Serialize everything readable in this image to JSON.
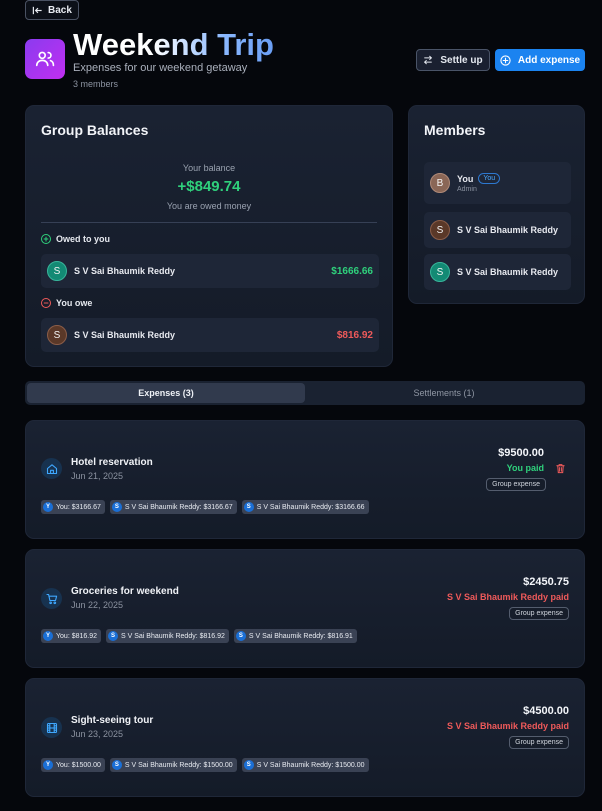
{
  "nav": {
    "back_label": "Back"
  },
  "header": {
    "title": "Weekend Trip",
    "subtitle": "Expenses for our weekend getaway",
    "member_count": "3 members",
    "settle_label": "Settle up",
    "add_label": "Add expense"
  },
  "balances": {
    "title": "Group Balances",
    "your_balance_label": "Your balance",
    "amount": "+$849.74",
    "status": "You are owed money",
    "owed_to_you": {
      "label": "Owed to you",
      "items": [
        {
          "initial": "S",
          "name": "S V Sai Bhaumik Reddy",
          "amount": "$1666.66"
        }
      ]
    },
    "you_owe": {
      "label": "You owe",
      "items": [
        {
          "initial": "S",
          "name": "S V Sai Bhaumik Reddy",
          "amount": "$816.92"
        }
      ]
    }
  },
  "members": {
    "title": "Members",
    "items": [
      {
        "initial": "B",
        "name": "You",
        "badge": "You",
        "role": "Admin"
      },
      {
        "initial": "S",
        "name": "S V Sai Bhaumik Reddy"
      },
      {
        "initial": "S",
        "name": "S V Sai Bhaumik Reddy"
      }
    ]
  },
  "tabs": [
    {
      "label": "Expenses (3)",
      "active": true
    },
    {
      "label": "Settlements (1)",
      "active": false
    }
  ],
  "expenses": [
    {
      "icon": "home-icon",
      "title": "Hotel reservation",
      "date": "Jun 21, 2025",
      "amount": "$9500.00",
      "payer": "You paid",
      "badge": "Group expense",
      "splits": [
        {
          "initial": "Y",
          "text": "You: $3166.67"
        },
        {
          "initial": "S",
          "text": "S V Sai Bhaumik Reddy: $3166.67"
        },
        {
          "initial": "S",
          "text": "S V Sai Bhaumik Reddy: $3166.66"
        }
      ]
    },
    {
      "icon": "cart-icon",
      "title": "Groceries for weekend",
      "date": "Jun 22, 2025",
      "amount": "$2450.75",
      "payer": "S V Sai Bhaumik Reddy paid",
      "badge": "Group expense",
      "splits": [
        {
          "initial": "Y",
          "text": "You: $816.92"
        },
        {
          "initial": "S",
          "text": "S V Sai Bhaumik Reddy: $816.92"
        },
        {
          "initial": "S",
          "text": "S V Sai Bhaumik Reddy: $816.91"
        }
      ]
    },
    {
      "icon": "film-icon",
      "title": "Sight-seeing tour",
      "date": "Jun 23, 2025",
      "amount": "$4500.00",
      "payer": "S V Sai Bhaumik Reddy paid",
      "badge": "Group expense",
      "splits": [
        {
          "initial": "Y",
          "text": "You: $1500.00"
        },
        {
          "initial": "S",
          "text": "S V Sai Bhaumik Reddy: $1500.00"
        },
        {
          "initial": "S",
          "text": "S V Sai Bhaumik Reddy: $1500.00"
        }
      ]
    }
  ],
  "colors": {
    "accent": "#1b83f0",
    "positive": "#2fd17c",
    "negative": "#ef5a5a",
    "brand_gradient_start": "#8b3bef"
  }
}
